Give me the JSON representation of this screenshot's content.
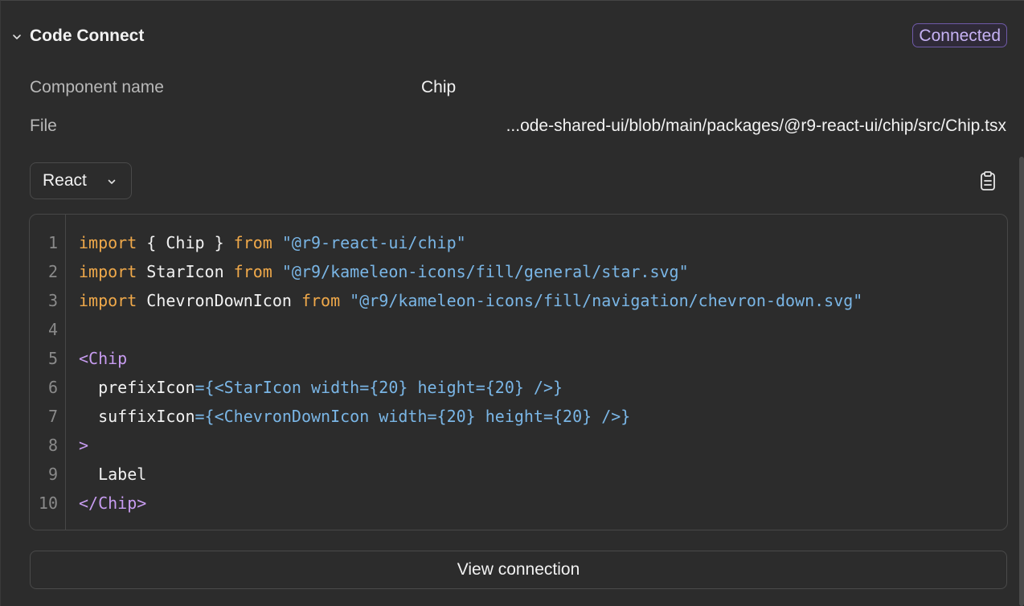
{
  "header": {
    "title": "Code Connect",
    "status_badge": "Connected"
  },
  "properties": [
    {
      "label": "Component name",
      "value": "Chip"
    },
    {
      "label": "File",
      "value": "...ode-shared-ui/blob/main/packages/@r9-react-ui/chip/src/Chip.tsx"
    }
  ],
  "language_select": {
    "value": "React"
  },
  "code": {
    "line_numbers": [
      "1",
      "2",
      "3",
      "4",
      "5",
      "6",
      "7",
      "8",
      "9",
      "10"
    ],
    "lines": [
      [
        {
          "t": "kw",
          "v": "import"
        },
        {
          "t": "plain",
          "v": " { Chip } "
        },
        {
          "t": "kw",
          "v": "from"
        },
        {
          "t": "plain",
          "v": " "
        },
        {
          "t": "str",
          "v": "\"@r9-react-ui/chip\""
        }
      ],
      [
        {
          "t": "kw",
          "v": "import"
        },
        {
          "t": "plain",
          "v": " StarIcon "
        },
        {
          "t": "kw",
          "v": "from"
        },
        {
          "t": "plain",
          "v": " "
        },
        {
          "t": "str",
          "v": "\"@r9/kameleon-icons/fill/general/star.svg\""
        }
      ],
      [
        {
          "t": "kw",
          "v": "import"
        },
        {
          "t": "plain",
          "v": " ChevronDownIcon "
        },
        {
          "t": "kw",
          "v": "from"
        },
        {
          "t": "plain",
          "v": " "
        },
        {
          "t": "str",
          "v": "\"@r9/kameleon-icons/fill/navigation/chevron-down.svg\""
        }
      ],
      [],
      [
        {
          "t": "tag",
          "v": "<Chip"
        }
      ],
      [
        {
          "t": "plain",
          "v": "  prefixIcon"
        },
        {
          "t": "exp",
          "v": "={<StarIcon width={20} height={20} />}"
        }
      ],
      [
        {
          "t": "plain",
          "v": "  suffixIcon"
        },
        {
          "t": "exp",
          "v": "={<ChevronDownIcon width={20} height={20} />}"
        }
      ],
      [
        {
          "t": "tag",
          "v": ">"
        }
      ],
      [
        {
          "t": "plain",
          "v": "  Label"
        }
      ],
      [
        {
          "t": "tag",
          "v": "</Chip>"
        }
      ]
    ]
  },
  "actions": {
    "view_connection": "View connection"
  },
  "icons": {
    "collapse": "chevron-down-icon",
    "dropdown": "chevron-down-icon",
    "copy": "clipboard-icon"
  }
}
